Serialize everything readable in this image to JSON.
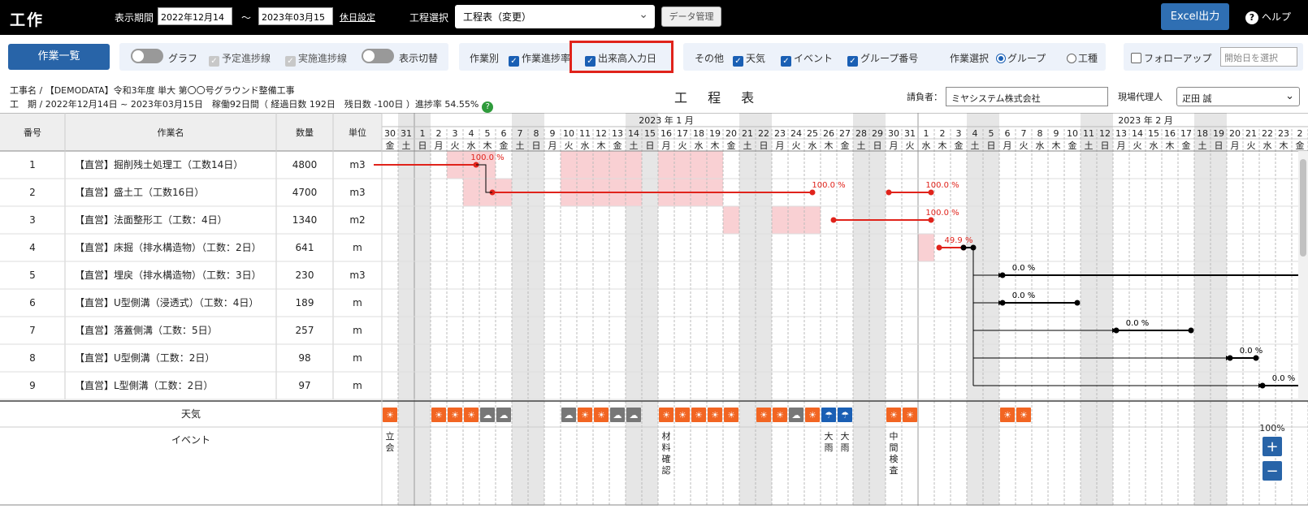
{
  "app": {
    "logo": "工作"
  },
  "header": {
    "period_label": "表示期間",
    "date_from": "2022年12月14日",
    "tilde": "〜",
    "date_to": "2023年03月15日",
    "holiday_link": "休日設定",
    "process_label": "工程選択",
    "process_value": "工程表（変更）",
    "data_mgmt": "データ管理",
    "excel": "Excel出力",
    "help": "ヘルプ"
  },
  "toolbar": {
    "list_button": "作業一覧",
    "graph": "グラフ",
    "plan_line": "予定進捗線",
    "actual_line": "実施進捗線",
    "display_switch": "表示切替",
    "by_task": "作業別",
    "task_progress": "作業進捗率",
    "output_date": "出来高入力日",
    "other": "その他",
    "weather": "天気",
    "event": "イベント",
    "group_no": "グループ番号",
    "task_select": "作業選択",
    "group": "グループ",
    "process": "工種",
    "follow_up": "フォローアップ",
    "start_placeholder": "開始日を選択"
  },
  "info": {
    "project": "工事名 / 【DEMODATA】令和3年度 単大 第〇〇号グラウンド整備工事",
    "period": "工　期 / 2022年12月14日 ~ 2023年03月15日　稼働92日間（ 経過日数 192日　残日数 -100日 ）進捗率 54.55%",
    "title": "工 程 表",
    "contractor_label": "請負者：",
    "contractor": "ミヤシステム株式会社",
    "agent_label": "現場代理人",
    "agent": "疋田 誠"
  },
  "columns": [
    "番号",
    "作業名",
    "数量",
    "単位"
  ],
  "tasks": [
    {
      "no": "1",
      "name": "【直営】掘削残土処理工（工数14日）",
      "qty": "4800",
      "unit": "m3"
    },
    {
      "no": "2",
      "name": "【直営】盛土工（工数16日）",
      "qty": "4700",
      "unit": "m3"
    },
    {
      "no": "3",
      "name": "【直営】法面整形工（工数：4日）",
      "qty": "1340",
      "unit": "m2"
    },
    {
      "no": "4",
      "name": "【直営】床掘（排水構造物）（工数：2日）",
      "qty": "641",
      "unit": "m"
    },
    {
      "no": "5",
      "name": "【直営】埋戻（排水構造物）（工数：3日）",
      "qty": "230",
      "unit": "m3"
    },
    {
      "no": "6",
      "name": "【直営】U型側溝（浸透式）（工数：4日）",
      "qty": "189",
      "unit": "m"
    },
    {
      "no": "7",
      "name": "【直営】落蓋側溝（工数：5日）",
      "qty": "257",
      "unit": "m"
    },
    {
      "no": "8",
      "name": "【直営】U型側溝（工数：2日）",
      "qty": "98",
      "unit": "m"
    },
    {
      "no": "9",
      "name": "【直営】L型側溝（工数：2日）",
      "qty": "97",
      "unit": "m"
    }
  ],
  "footer_rows": {
    "weather": "天気",
    "event": "イベント"
  },
  "months": [
    "2023 年 1 月",
    "2023 年 2 月"
  ],
  "days": [
    "30",
    "31",
    "1",
    "2",
    "3",
    "4",
    "5",
    "6",
    "7",
    "8",
    "9",
    "10",
    "11",
    "12",
    "13",
    "14",
    "15",
    "16",
    "17",
    "18",
    "19",
    "20",
    "21",
    "22",
    "23",
    "24",
    "25",
    "26",
    "27",
    "28",
    "29",
    "30",
    "31",
    "1",
    "2",
    "3",
    "4",
    "5",
    "6",
    "7",
    "8",
    "9",
    "10",
    "11",
    "12",
    "13",
    "14",
    "15",
    "16",
    "17",
    "18",
    "19",
    "20",
    "21",
    "22",
    "23",
    "2"
  ],
  "weekdays": [
    "金",
    "土",
    "日",
    "月",
    "火",
    "水",
    "木",
    "金",
    "土",
    "日",
    "月",
    "火",
    "水",
    "木",
    "金",
    "土",
    "日",
    "月",
    "火",
    "水",
    "木",
    "金",
    "土",
    "日",
    "月",
    "火",
    "水",
    "木",
    "金",
    "土",
    "日",
    "月",
    "火",
    "水",
    "木",
    "金",
    "土",
    "日",
    "月",
    "火",
    "水",
    "木",
    "金",
    "土",
    "日",
    "月",
    "火",
    "水",
    "木",
    "金",
    "土",
    "日",
    "月",
    "火",
    "水",
    "木",
    "金"
  ],
  "bars": [
    {
      "row": 0,
      "from": -0.5,
      "to": 5.8,
      "label": "100.0 %",
      "label_day": 5.5,
      "color": "#e0231b"
    },
    {
      "row": 1,
      "from": 6.8,
      "to": 26.5,
      "label": "100.0 %",
      "label_day": 26.5,
      "color": "#e0231b"
    },
    {
      "row": 1,
      "from": 31.2,
      "to": 33.8,
      "label": "100.0 %",
      "label_day": 33.5,
      "color": "#e0231b"
    },
    {
      "row": 2,
      "from": 27.8,
      "to": 33.8,
      "label": "100.0 %",
      "label_day": 33.5,
      "color": "#e0231b"
    },
    {
      "row": 3,
      "from": 34.3,
      "to": 35.8,
      "label": "49.9 %",
      "label_day": 34.5,
      "color": "#e0231b"
    },
    {
      "row": 3,
      "from": 35.8,
      "to": 36.4,
      "label": "",
      "label_day": 0,
      "color": "#000"
    },
    {
      "row": 4,
      "from": 38.2,
      "to": 56.5,
      "label": "0.0 %",
      "label_day": 38.5,
      "color": "#000"
    },
    {
      "row": 5,
      "from": 38.2,
      "to": 42.8,
      "label": "0.0 %",
      "label_day": 38.5,
      "color": "#000"
    },
    {
      "row": 6,
      "from": 45.2,
      "to": 49.8,
      "label": "0.0 %",
      "label_day": 45.5,
      "color": "#000"
    },
    {
      "row": 7,
      "from": 52.2,
      "to": 53.8,
      "label": "0.0 %",
      "label_day": 52.5,
      "color": "#000"
    },
    {
      "row": 8,
      "from": 54.2,
      "to": 56.5,
      "label": "0.0 %",
      "label_day": 54.5,
      "color": "#000"
    }
  ],
  "pink_cells": [
    {
      "row": 0,
      "days": [
        4,
        5,
        6,
        11,
        12,
        13,
        14,
        15,
        17,
        18,
        19,
        20
      ]
    },
    {
      "row": 1,
      "days": [
        5,
        6,
        7,
        11,
        12,
        13,
        14,
        15,
        17,
        18,
        19,
        20
      ]
    },
    {
      "row": 2,
      "days": [
        21,
        24,
        25,
        26
      ]
    },
    {
      "row": 3,
      "days": [
        33
      ]
    }
  ],
  "weather": [
    {
      "day": 0,
      "icon": "sunny-icon"
    },
    {
      "day": 3,
      "icon": "sunny-icon"
    },
    {
      "day": 4,
      "icon": "sunny-cloudy-icon"
    },
    {
      "day": 5,
      "icon": "sunny-icon"
    },
    {
      "day": 6,
      "icon": "cloudy-sunny-icon"
    },
    {
      "day": 7,
      "icon": "cloudy-sunny-icon"
    },
    {
      "day": 11,
      "icon": "cloudy-sunny-icon"
    },
    {
      "day": 12,
      "icon": "sunny-rain-icon"
    },
    {
      "day": 13,
      "icon": "sunny-icon"
    },
    {
      "day": 14,
      "icon": "cloudy-icon"
    },
    {
      "day": 15,
      "icon": "cloudy-rain-icon"
    },
    {
      "day": 17,
      "icon": "sunny-icon"
    },
    {
      "day": 18,
      "icon": "sunny-icon"
    },
    {
      "day": 19,
      "icon": "sunny-icon"
    },
    {
      "day": 20,
      "icon": "sunny-icon"
    },
    {
      "day": 21,
      "icon": "sunny-icon"
    },
    {
      "day": 23,
      "icon": "sunny-icon"
    },
    {
      "day": 24,
      "icon": "sunny-cloudy-icon"
    },
    {
      "day": 25,
      "icon": "cloudy-icon"
    },
    {
      "day": 26,
      "icon": "sunny-icon"
    },
    {
      "day": 27,
      "icon": "rain-icon"
    },
    {
      "day": 28,
      "icon": "rain-icon"
    },
    {
      "day": 31,
      "icon": "sunny-icon"
    },
    {
      "day": 32,
      "icon": "sunny-icon"
    },
    {
      "day": 38,
      "icon": "sunny-icon"
    },
    {
      "day": 39,
      "icon": "sunny-icon"
    }
  ],
  "events": [
    {
      "day": 0,
      "text": "立会"
    },
    {
      "day": 17,
      "text": "材料確認"
    },
    {
      "day": 27,
      "text": "大雨"
    },
    {
      "day": 28,
      "text": "大雨"
    },
    {
      "day": 31,
      "text": "中間検査"
    }
  ],
  "zoom": "100%",
  "zoom_in": "+",
  "zoom_out": "−",
  "colors": {
    "accent": "#2864a8",
    "progress_red": "#e0231b",
    "weekend_gray": "#e6e6e6",
    "planned_pink": "#f9d0d3",
    "weather_orange": "#f26522",
    "weather_blue": "#1a5fb4"
  }
}
